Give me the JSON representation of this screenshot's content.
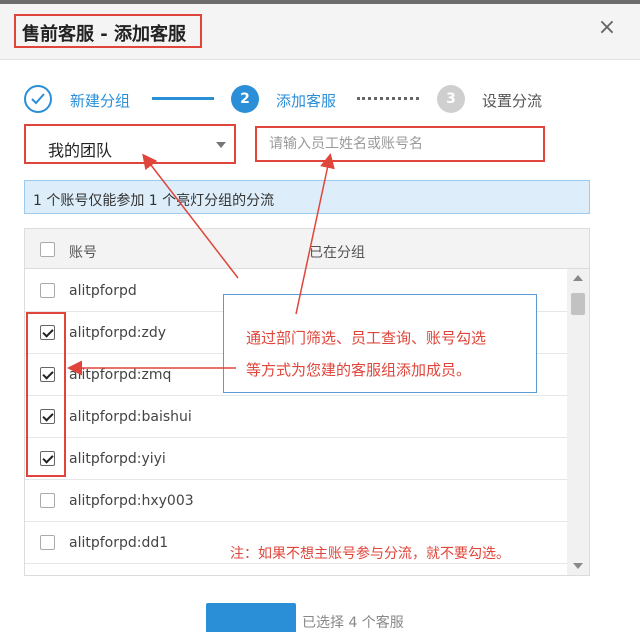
{
  "dialog": {
    "title": "售前客服 - 添加客服",
    "close_label": "×"
  },
  "steps": [
    {
      "number": "",
      "label": "新建分组",
      "state": "done"
    },
    {
      "number": "2",
      "label": "添加客服",
      "state": "active"
    },
    {
      "number": "3",
      "label": "设置分流",
      "state": "pending"
    }
  ],
  "filter": {
    "team_select": "我的团队",
    "search_placeholder": "请输入员工姓名或账号名"
  },
  "notice": "1 个账号仅能参加 1 个亮灯分组的分流",
  "table": {
    "headers": {
      "account": "账号",
      "group": "已在分组"
    },
    "rows": [
      {
        "account": "alitpforpd",
        "checked": false
      },
      {
        "account": "alitpforpd:zdy",
        "checked": true
      },
      {
        "account": "alitpforpd:zmq",
        "checked": true
      },
      {
        "account": "alitpforpd:baishui",
        "checked": true
      },
      {
        "account": "alitpforpd:yiyi",
        "checked": true
      },
      {
        "account": "alitpforpd:hxy003",
        "checked": false
      },
      {
        "account": "alitpforpd:dd1",
        "checked": false
      }
    ]
  },
  "annotations": {
    "callout_line1": "通过部门筛选、员工查询、账号勾选",
    "callout_line2": "等方式为您建的客服组添加成员。",
    "note": "注：如果不想主账号参与分流，就不要勾选。"
  },
  "footer": {
    "selected_text": "已选择 4 个客服"
  },
  "colors": {
    "accent": "#2b8fd8",
    "annotation_red": "#e0453b",
    "notice_bg": "#ddeefa"
  }
}
